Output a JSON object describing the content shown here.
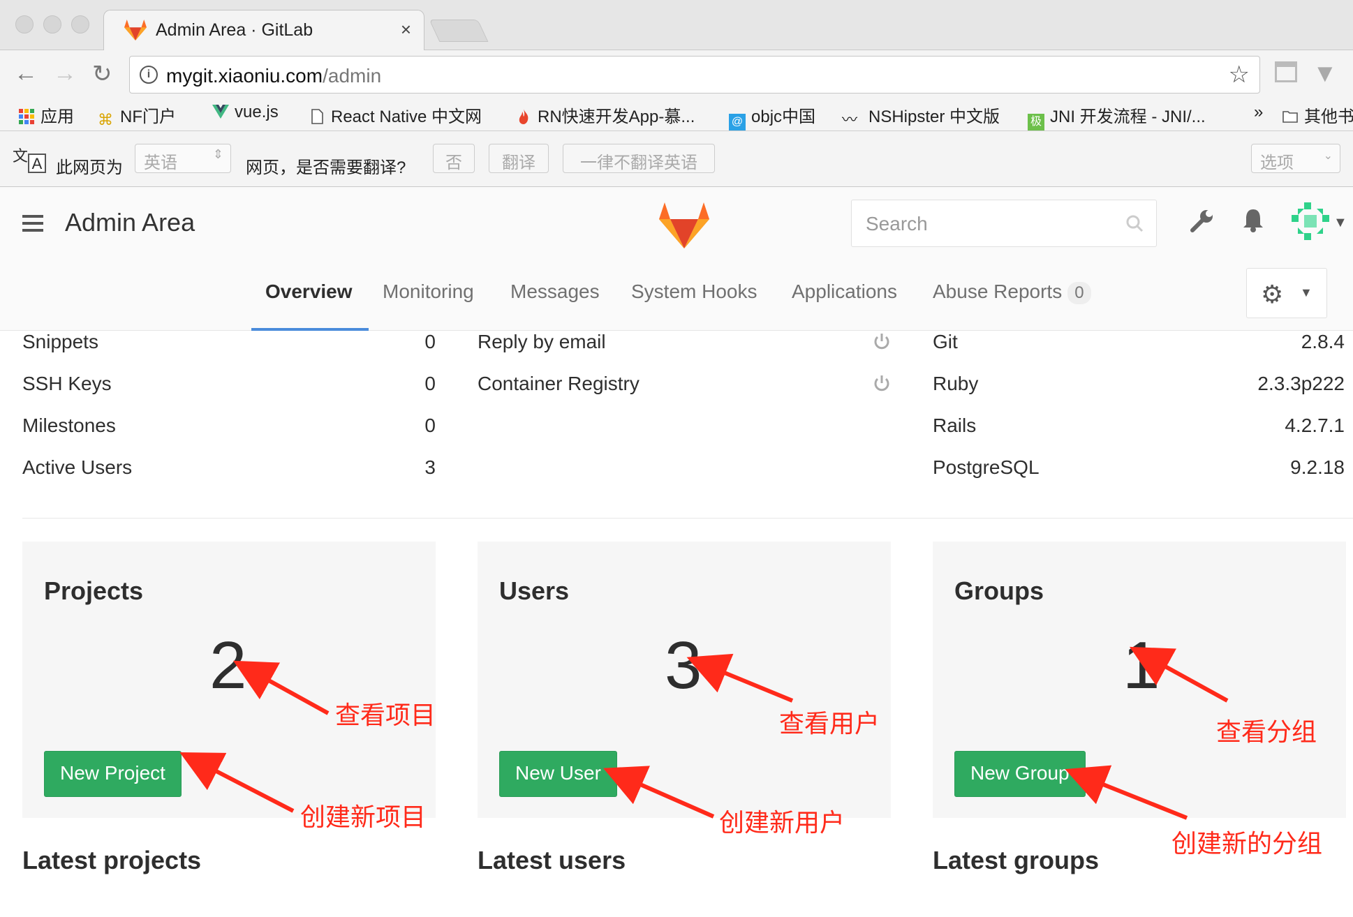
{
  "browser": {
    "tab_title": "Admin Area · GitLab",
    "tab_close": "×",
    "url_host": "mygit.xiaoniu.com",
    "url_path": "/admin",
    "bookmarks": [
      {
        "label": "应用",
        "icon": "apps-grid-icon"
      },
      {
        "label": "NF门户",
        "icon": "bookmark-site-icon"
      },
      {
        "label": "vue.js",
        "icon": "vue-icon"
      },
      {
        "label": "React Native 中文网",
        "icon": "page-icon"
      },
      {
        "label": "RN快速开发App-慕...",
        "icon": "flame-icon"
      },
      {
        "label": "objc中国",
        "icon": "objc-icon"
      },
      {
        "label": "NSHipster 中文版",
        "icon": "mustache-icon"
      },
      {
        "label": "JNI 开发流程 - JNI/...",
        "icon": "site-icon"
      },
      {
        "label": "»",
        "icon": ""
      },
      {
        "label": "其他书",
        "icon": "folder-icon"
      }
    ]
  },
  "translate_bar": {
    "prefix": "此网页为",
    "language": "英语",
    "question": "网页，是否需要翻译?",
    "no_btn": "否",
    "translate_btn": "翻译",
    "never_btn": "一律不翻译英语",
    "options": "选项"
  },
  "header": {
    "title": "Admin Area",
    "search_placeholder": "Search"
  },
  "nav": {
    "tabs": [
      "Overview",
      "Monitoring",
      "Messages",
      "System Hooks",
      "Applications",
      "Abuse Reports"
    ],
    "abuse_count": "0"
  },
  "stats": {
    "counts": [
      {
        "label": "Snippets",
        "value": "0"
      },
      {
        "label": "SSH Keys",
        "value": "0"
      },
      {
        "label": "Milestones",
        "value": "0"
      },
      {
        "label": "Active Users",
        "value": "3"
      }
    ],
    "features": [
      {
        "label": "Reply by email",
        "icon": "power-icon"
      },
      {
        "label": "Container Registry",
        "icon": "power-icon"
      }
    ],
    "components": [
      {
        "label": "Git",
        "value": "2.8.4"
      },
      {
        "label": "Ruby",
        "value": "2.3.3p222"
      },
      {
        "label": "Rails",
        "value": "4.2.7.1"
      },
      {
        "label": "PostgreSQL",
        "value": "9.2.18"
      }
    ]
  },
  "cards": [
    {
      "title": "Projects",
      "count": "2",
      "button": "New Project",
      "latest": "Latest projects"
    },
    {
      "title": "Users",
      "count": "3",
      "button": "New User",
      "latest": "Latest users"
    },
    {
      "title": "Groups",
      "count": "1",
      "button": "New Group",
      "latest": "Latest groups"
    }
  ],
  "annotations": {
    "view_projects": "查看项目",
    "new_project": "创建新项目",
    "view_users": "查看用户",
    "new_user": "创建新用户",
    "view_groups": "查看分组",
    "new_group": "创建新的分组"
  },
  "colors": {
    "green_button": "#2faa60",
    "annotation_red": "#ff2a1a",
    "active_tab_underline": "#4a8bdb"
  }
}
